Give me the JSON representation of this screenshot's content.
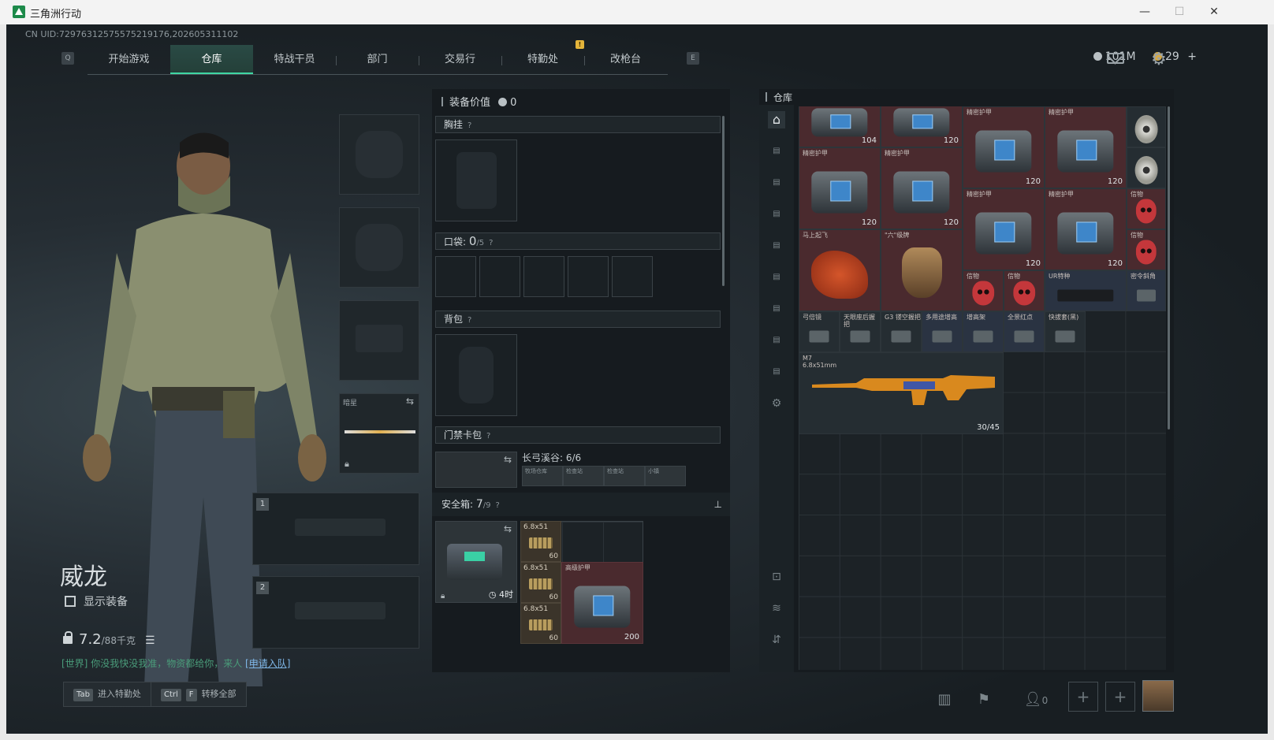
{
  "window": {
    "title": "三角洲行动",
    "minimize": "—",
    "maximize": "☐",
    "close": "✕"
  },
  "uid": "CN UID:7297631257557521917­6,202605311102",
  "nav": {
    "left_key": "Q",
    "right_key": "E",
    "notice": "!",
    "tabs": [
      "开始游戏",
      "仓库",
      "特战干员",
      "部门",
      "交易行",
      "特勤处",
      "改枪台"
    ],
    "active": "仓库"
  },
  "currency": {
    "silver": "101M",
    "gold": "29",
    "add": "+"
  },
  "operator": {
    "name": "威龙",
    "show_equipment": "显示装备",
    "weight": "7.2",
    "weight_max": "/88千克"
  },
  "chat": {
    "channel": "[世界]",
    "text": "你没我快没我准，物资都给你，来人",
    "link": "[申请入队]"
  },
  "bottom_buttons": [
    {
      "key": "Tab",
      "label": "进入特勤处"
    },
    {
      "key1": "Ctrl",
      "key2": "F",
      "label": "转移全部"
    }
  ],
  "slots": {
    "melee_label": "暗星",
    "slot1": "1",
    "slot2": "2"
  },
  "loadout": {
    "value_label": "装备价值",
    "value": "0",
    "chest": "胸挂",
    "pocket": "口袋:",
    "pocket_used": "0",
    "pocket_max": "/5",
    "backpack": "背包",
    "keycard": "门禁卡包",
    "keycard_map": "长弓溪谷: 6/6",
    "keycard_tags": [
      "牧场仓库",
      "检查站",
      "检查站",
      "小镇"
    ],
    "safe": "安全箱:",
    "safe_used": "7",
    "safe_max": "/9",
    "safe_timer": "4时",
    "help": "?"
  },
  "safe_items": [
    {
      "name": "6.8x51",
      "count": "60"
    },
    {
      "name": "6.8x51",
      "count": "60"
    },
    {
      "name": "6.8x51",
      "count": "60"
    },
    {
      "name": "高级护甲",
      "value": "200"
    }
  ],
  "warehouse": {
    "title": "仓库",
    "items": {
      "armor_a": {
        "value": "104"
      },
      "armor_b": {
        "value": "120"
      },
      "precise_armor": "精密护甲",
      "armor_value": "120",
      "horse": "马上起飞",
      "hand": "\"六\"级牌",
      "mask": "信物",
      "ur_grip": "UR特种",
      "small": "密令斜角",
      "att": [
        "弓倍镜",
        "天眼座后握把",
        "G3 镂空握把",
        "多用途增高",
        "增高架",
        "全景红点",
        "快拔套(黑)"
      ],
      "gun_name": "M7",
      "gun_caliber": "6.8x51mm",
      "gun_ammo": "30/45"
    }
  },
  "bottom_right": {
    "friends": "0",
    "plus": "+"
  }
}
